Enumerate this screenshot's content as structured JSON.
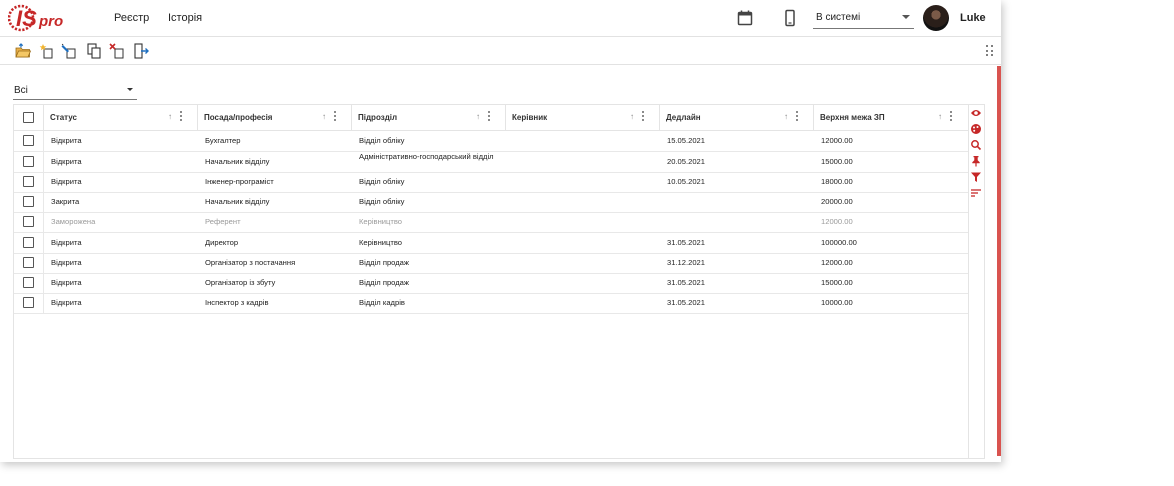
{
  "header": {
    "nav": [
      "Реєстр",
      "Історія"
    ],
    "state_select": "В системі",
    "username": "Luke",
    "icons": [
      "calendar-icon",
      "phone-icon"
    ]
  },
  "toolbar": {
    "buttons": [
      "open-folder-icon",
      "add-icon",
      "edit-icon",
      "copy-icon",
      "delete-icon",
      "exit-icon"
    ]
  },
  "filter": {
    "value": "Всі"
  },
  "table": {
    "columns": [
      "Статус",
      "Посада/професія",
      "Підрозділ",
      "Керівник",
      "Дедлайн",
      "Верхня межа ЗП"
    ],
    "rows": [
      {
        "status": "Відкрита",
        "position": "Бухгалтер",
        "department": "Відділ обліку",
        "manager": "",
        "deadline": "15.05.2021",
        "salary": "12000.00"
      },
      {
        "status": "Відкрита",
        "position": "Начальник відділу",
        "department": "Адміністративно-господарський відділ",
        "manager": "",
        "deadline": "20.05.2021",
        "salary": "15000.00"
      },
      {
        "status": "Відкрита",
        "position": "Інженер-програміст",
        "department": "Відділ обліку",
        "manager": "",
        "deadline": "10.05.2021",
        "salary": "18000.00"
      },
      {
        "status": "Закрита",
        "position": "Начальник відділу",
        "department": "Відділ обліку",
        "manager": "",
        "deadline": "",
        "salary": "20000.00"
      },
      {
        "status": "Заморожена",
        "position": "Референт",
        "department": "Керівництво",
        "manager": "",
        "deadline": "",
        "salary": "12000.00",
        "frozen": true
      },
      {
        "status": "Відкрита",
        "position": "Директор",
        "department": "Керівництво",
        "manager": "",
        "deadline": "31.05.2021",
        "salary": "100000.00"
      },
      {
        "status": "Відкрита",
        "position": "Організатор з постачання",
        "department": "Відділ продаж",
        "manager": "",
        "deadline": "31.12.2021",
        "salary": "12000.00"
      },
      {
        "status": "Відкрита",
        "position": "Організатор із збуту",
        "department": "Відділ продаж",
        "manager": "",
        "deadline": "31.05.2021",
        "salary": "15000.00"
      },
      {
        "status": "Відкрита",
        "position": "Інспектор з кадрів",
        "department": "Відділ кадрів",
        "manager": "",
        "deadline": "31.05.2021",
        "salary": "10000.00"
      }
    ]
  },
  "side_panel": [
    "eye-icon",
    "palette-icon",
    "search-icon",
    "pin-icon",
    "filter-icon",
    "sort-icon"
  ],
  "colors": {
    "accent": "#c62828",
    "scrollbar": "#d9534f",
    "frozen_text": "#9a9a9a"
  }
}
